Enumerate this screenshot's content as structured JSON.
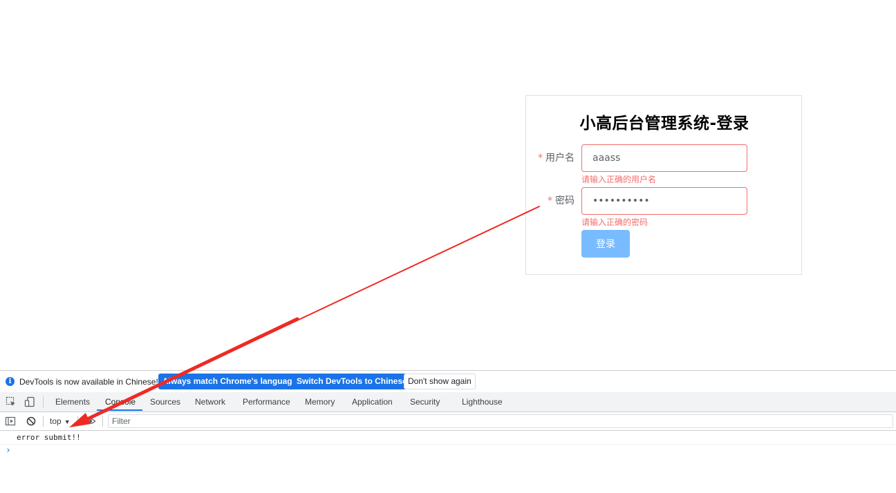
{
  "login": {
    "title": "小高后台管理系统-登录",
    "required_mark": "*",
    "username": {
      "label": "用户名",
      "value": "aaass",
      "error": "请输入正确的用户名"
    },
    "password": {
      "label": "密码",
      "value": "••••••••••",
      "error": "请输入正确的密码"
    },
    "submit_label": "登录"
  },
  "devtools": {
    "infobar": {
      "icon": "info-icon",
      "icon_glyph": "i",
      "message": "DevTools is now available in Chinese!",
      "buttons": [
        "Always match Chrome's language",
        "Switch DevTools to Chinese",
        "Don't show again"
      ]
    },
    "tabs": [
      "Elements",
      "Console",
      "Sources",
      "Network",
      "Performance",
      "Memory",
      "Application",
      "Security",
      "Lighthouse"
    ],
    "active_tab": "Console",
    "console": {
      "context": "top",
      "filter_placeholder": "Filter",
      "messages": [
        "error submit!!"
      ],
      "prompt": "›"
    }
  },
  "colors": {
    "error": "#f56c6c",
    "button_disabled_blue": "#79bbff",
    "devtools_blue": "#1a73e8",
    "annotation_arrow": "#ee2a24"
  }
}
